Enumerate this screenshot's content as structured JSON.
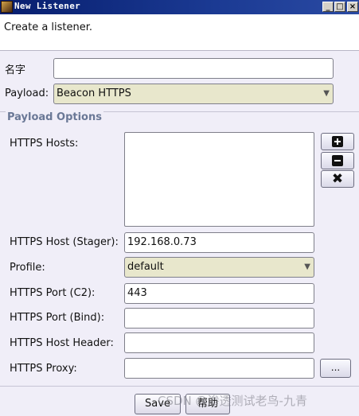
{
  "window": {
    "title": "New Listener",
    "controls": {
      "minimize": "_",
      "maximize": "□",
      "close": "×"
    }
  },
  "description": "Create a listener.",
  "form": {
    "name_label": "名字",
    "name_value": "",
    "payload_label": "Payload:",
    "payload_value": "Beacon HTTPS"
  },
  "payload_options": {
    "title": "Payload Options",
    "hosts_label": "HTTPS Hosts:",
    "hosts": [],
    "host_buttons": [
      "add-icon",
      "remove-icon",
      "clear-icon"
    ],
    "stager_label": "HTTPS Host (Stager):",
    "stager_value": "192.168.0.73",
    "profile_label": "Profile:",
    "profile_value": "default",
    "port_c2_label": "HTTPS Port (C2):",
    "port_c2_value": "443",
    "port_bind_label": "HTTPS Port (Bind):",
    "port_bind_value": "",
    "host_header_label": "HTTPS Host Header:",
    "host_header_value": "",
    "proxy_label": "HTTPS Proxy:",
    "proxy_value": "",
    "proxy_button": "..."
  },
  "buttons": {
    "save": "Save",
    "help": "帮助"
  },
  "watermark": "CSDN @渗透测试老鸟-九青",
  "colors": {
    "titlebar": "#071e6e",
    "combo_bg": "#e8e7cc",
    "group_title": "#6a7896",
    "window_bg": "#f0eef8"
  }
}
